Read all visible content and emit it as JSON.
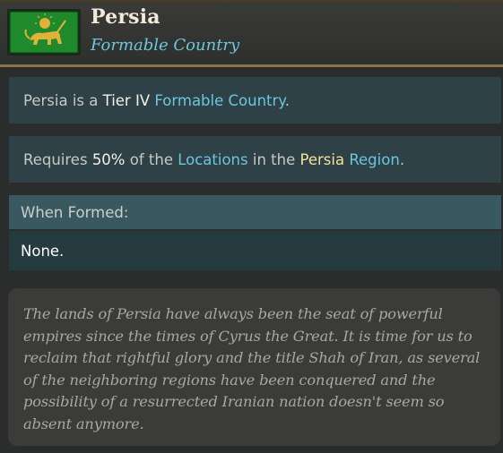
{
  "header": {
    "title": "Persia",
    "subtitle": "Formable Country",
    "flag_icon": "lion-and-sun-flag-icon"
  },
  "tier_line": {
    "t1": "Persia is a ",
    "t2": "Tier IV",
    "t3": " ",
    "t4": "Formable Country",
    "t5": "."
  },
  "requirement_line": {
    "t1": "Requires ",
    "t2": "50%",
    "t3": " of the ",
    "t4": "Locations",
    "t5": " in the ",
    "t6": "Persia",
    "t7": " ",
    "t8": "Region",
    "t9": "."
  },
  "when_formed": {
    "header": "When Formed:",
    "value": "None."
  },
  "description": "The lands of Persia have always been the seat of powerful empires since the times of Cyrus the Great. It is time for us to reclaim that rightful glory and the title Shah of Iran, as several of the neighboring regions have been conquered and the possibility of a resurrected Iranian nation doesn't seem so absent anymore.",
  "colors": {
    "accent_blue": "#6cc6de",
    "accent_yellow": "#f3e49a",
    "gold_border": "#8a7448",
    "flag_green": "#1f8a2b",
    "emblem_gold": "#e0b23a"
  }
}
